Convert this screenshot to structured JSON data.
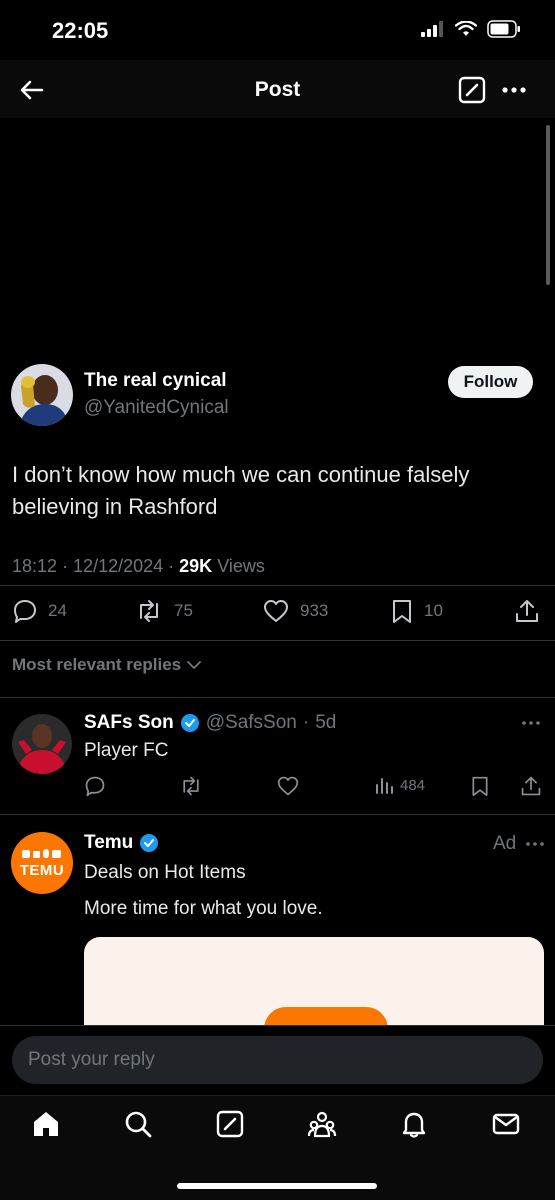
{
  "status": {
    "time": "22:05"
  },
  "header": {
    "title": "Post"
  },
  "post": {
    "author_name": "The real cynical",
    "author_handle": "@YanitedCynical",
    "follow_label": "Follow",
    "text": "I don’t know how much we can continue falsely believing in Rashford",
    "time": "18:12",
    "date": "12/12/2024",
    "views_count": "29K",
    "views_label": "Views",
    "replies": "24",
    "reposts": "75",
    "likes": "933",
    "bookmarks": "10"
  },
  "replies_filter": {
    "label": "Most relevant replies"
  },
  "reply": {
    "name": "SAFs Son",
    "handle": "@SafsSon",
    "age": "5d",
    "text": "Player FC",
    "views": "484"
  },
  "ad": {
    "name": "Temu",
    "label": "Ad",
    "line1": "Deals on Hot Items",
    "line2": "More time for what you love.",
    "logo_text": "TEMU",
    "brand_color": "#fb7701"
  },
  "reply_box": {
    "placeholder": "Post your reply"
  },
  "tabs": [
    "home-icon",
    "search-icon",
    "compose-icon",
    "communities-icon",
    "notifications-icon",
    "messages-icon"
  ]
}
